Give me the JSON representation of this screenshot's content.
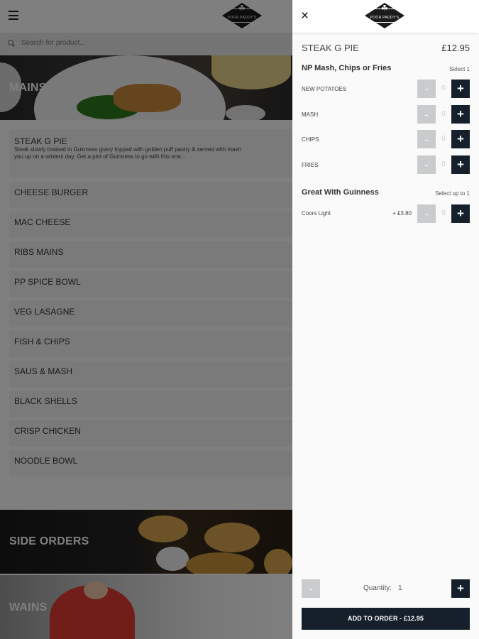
{
  "header": {
    "brand_logo_text": "POOR PADDY'S"
  },
  "search": {
    "placeholder": "Search for product..."
  },
  "categories": {
    "mains": "MAINS",
    "side_orders": "SIDE ORDERS",
    "wains": "WAINS"
  },
  "menu_items": [
    {
      "name": "STEAK G PIE",
      "description_line1": "Steak slowly braised in Guinness gravy topped with golden puff pastry & served with mash",
      "description_line2": "you up on a winters day. Get a pint of Guinness to go with this one..."
    },
    {
      "name": "CHEESE BURGER"
    },
    {
      "name": "MAC CHEESE"
    },
    {
      "name": "RIBS MAINS"
    },
    {
      "name": "PP SPICE BOWL"
    },
    {
      "name": "VEG LASAGNE"
    },
    {
      "name": "FISH & CHIPS"
    },
    {
      "name": "SAUS & MASH"
    },
    {
      "name": "BLACK SHELLS"
    },
    {
      "name": "CRISP CHICKEN"
    },
    {
      "name": "NOODLE BOWL"
    }
  ],
  "panel": {
    "close_symbol": "×",
    "product_name": "STEAK G PIE",
    "product_price": "£12.95",
    "groups": [
      {
        "title": "NP Mash, Chips or Fries",
        "hint": "Select 1",
        "options": [
          {
            "label": "NEW POTATOES",
            "qty": "0"
          },
          {
            "label": "MASH",
            "qty": "0"
          },
          {
            "label": "CHIPS",
            "qty": "0"
          },
          {
            "label": "FRIES",
            "qty": "0"
          }
        ]
      },
      {
        "title": "Great With Guinness",
        "hint": "Select up to 1",
        "options": [
          {
            "label": "Coors Light",
            "price": "+ £3.80",
            "qty": "0"
          }
        ]
      }
    ],
    "minus_symbol": "-",
    "plus_symbol": "+",
    "quantity_label": "Quantity:",
    "quantity_value": "1",
    "add_to_order_label": "ADD TO ORDER  -  £12.95"
  },
  "colors": {
    "accent_dark": "#16202b",
    "button_disabled": "#c9cbcd",
    "overlay": "rgba(0,0,0,0.5)"
  }
}
